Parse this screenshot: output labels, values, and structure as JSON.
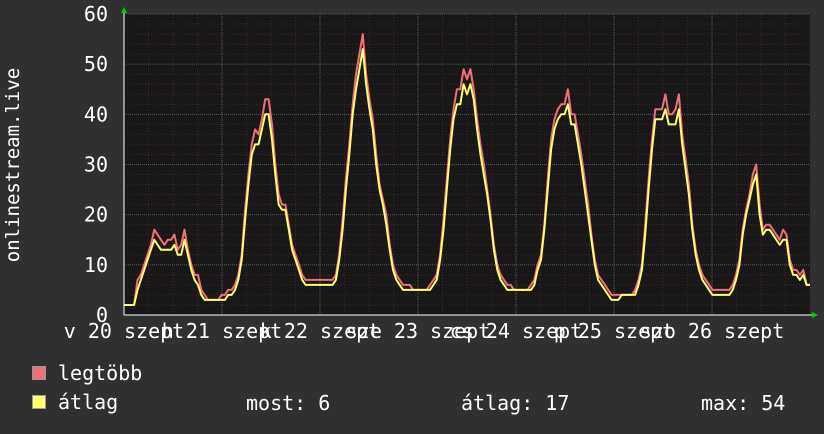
{
  "chart_data": {
    "type": "line",
    "ylabel": "onlinestream.live",
    "ylim": [
      0,
      60
    ],
    "y_ticks": [
      "0",
      "10",
      "20",
      "30",
      "40",
      "50",
      "60"
    ],
    "x_tick_labels": [
      "v 20 szept",
      "h 21 szept",
      "k 22 szept",
      "sze 23 szept",
      "cs 24 szept",
      "p 25 szept",
      "szo 26 szept"
    ],
    "grid": true,
    "colors": {
      "background": "#303030",
      "plot": "#181818",
      "grid_minor": "#4a2424",
      "grid_major": "#5a5a5a",
      "max_line": "#f07078",
      "avg_line": "#ffff70"
    },
    "days": 7,
    "samples_per_day": 24,
    "series": [
      {
        "name": "legtöbb",
        "values": [
          2,
          2,
          2,
          2,
          7,
          8,
          10,
          12,
          14,
          17,
          16,
          15,
          14,
          15,
          15,
          16,
          13,
          14,
          17,
          13,
          10,
          8,
          8,
          5,
          4,
          3,
          3,
          3,
          3,
          4,
          4,
          5,
          5,
          6,
          8,
          12,
          21,
          28,
          34,
          37,
          36,
          39,
          43,
          43,
          38,
          30,
          24,
          22,
          22,
          18,
          14,
          12,
          10,
          8,
          7,
          7,
          7,
          7,
          7,
          7,
          7,
          7,
          7,
          8,
          12,
          19,
          27,
          34,
          42,
          48,
          52,
          56,
          48,
          43,
          39,
          32,
          26,
          23,
          20,
          14,
          10,
          8,
          7,
          6,
          6,
          6,
          5,
          5,
          5,
          5,
          5,
          6,
          7,
          8,
          12,
          19,
          27,
          35,
          41,
          45,
          45,
          49,
          47,
          49,
          45,
          39,
          34,
          30,
          25,
          20,
          14,
          10,
          8,
          7,
          6,
          6,
          5,
          5,
          5,
          5,
          5,
          6,
          7,
          10,
          12,
          18,
          27,
          35,
          39,
          41,
          42,
          42,
          45,
          40,
          40,
          36,
          32,
          27,
          22,
          16,
          11,
          8,
          7,
          6,
          5,
          4,
          4,
          4,
          4,
          4,
          4,
          4,
          5,
          7,
          10,
          18,
          27,
          35,
          41,
          41,
          41,
          44,
          40,
          40,
          41,
          44,
          36,
          31,
          26,
          18,
          13,
          10,
          8,
          7,
          6,
          5,
          5,
          5,
          5,
          5,
          5,
          6,
          8,
          11,
          17,
          21,
          24,
          28,
          30,
          22,
          17,
          18,
          18,
          17,
          16,
          15,
          17,
          16,
          11,
          9,
          9,
          8,
          9,
          6,
          6
        ]
      },
      {
        "name": "átlag",
        "values": [
          2,
          2,
          2,
          2,
          5,
          7,
          9,
          11,
          13,
          15,
          14,
          13,
          13,
          13,
          13,
          14,
          12,
          12,
          15,
          12,
          9,
          7,
          6,
          4,
          3,
          3,
          3,
          3,
          3,
          3,
          3,
          4,
          4,
          5,
          7,
          11,
          19,
          26,
          32,
          34,
          34,
          37,
          40,
          40,
          35,
          28,
          22,
          21,
          21,
          17,
          13,
          11,
          9,
          7,
          6,
          6,
          6,
          6,
          6,
          6,
          6,
          6,
          6,
          7,
          11,
          17,
          25,
          32,
          40,
          45,
          49,
          53,
          46,
          41,
          37,
          30,
          25,
          22,
          18,
          13,
          9,
          7,
          6,
          5,
          5,
          5,
          5,
          5,
          5,
          5,
          5,
          5,
          6,
          7,
          11,
          17,
          25,
          33,
          39,
          42,
          42,
          46,
          44,
          46,
          43,
          37,
          32,
          28,
          24,
          19,
          13,
          9,
          7,
          6,
          5,
          5,
          5,
          5,
          5,
          5,
          5,
          5,
          6,
          9,
          11,
          17,
          25,
          33,
          37,
          39,
          40,
          40,
          42,
          38,
          38,
          34,
          30,
          25,
          20,
          15,
          10,
          7,
          6,
          5,
          4,
          3,
          3,
          3,
          4,
          4,
          4,
          4,
          4,
          6,
          9,
          16,
          25,
          33,
          39,
          39,
          39,
          41,
          38,
          38,
          38,
          41,
          34,
          29,
          24,
          17,
          12,
          9,
          7,
          6,
          5,
          4,
          4,
          4,
          4,
          4,
          4,
          5,
          7,
          10,
          16,
          20,
          23,
          26,
          28,
          20,
          16,
          17,
          17,
          16,
          15,
          14,
          15,
          15,
          10,
          8,
          8,
          7,
          8,
          6,
          6
        ]
      }
    ],
    "legend": [
      {
        "key": "max",
        "label": "legtöbb"
      },
      {
        "key": "avg",
        "label": "átlag"
      }
    ],
    "stats": {
      "now": "most: 6",
      "avg": "átlag: 17",
      "max": "max: 54"
    }
  }
}
